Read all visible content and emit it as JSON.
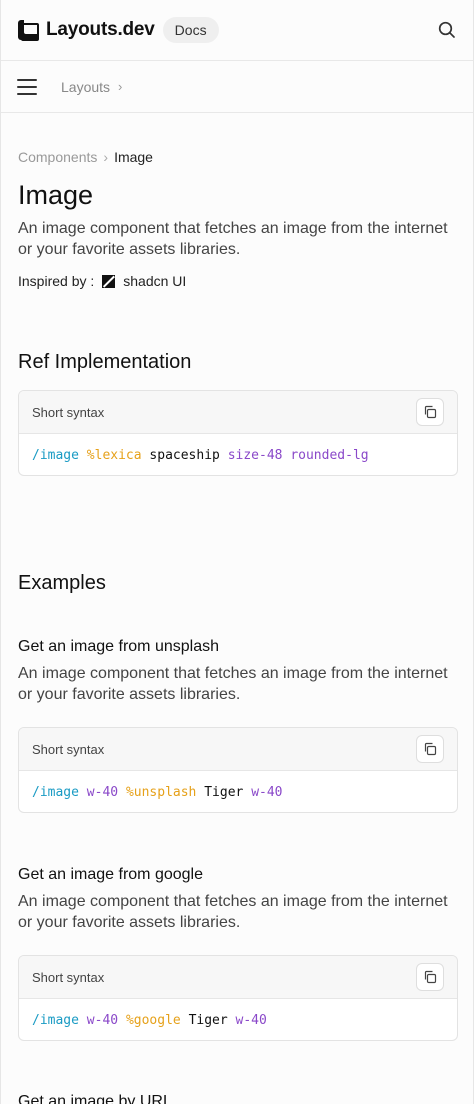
{
  "header": {
    "brand": "Layouts.dev",
    "docs_pill": "Docs"
  },
  "nav": {
    "crumb": "Layouts",
    "chevron": "›"
  },
  "breadcrumb": {
    "parent": "Components",
    "separator": "›",
    "current": "Image"
  },
  "page": {
    "title": "Image",
    "lead": "An image component that fetches an image from the internet or your favorite assets libraries.",
    "inspired_label": "Inspired by :",
    "inspired_name": "shadcn UI"
  },
  "ref": {
    "title": "Ref Implementation",
    "code": {
      "header": "Short syntax",
      "tokens": [
        "/image",
        " ",
        "%lexica",
        " ",
        "spaceship",
        " ",
        "size-48",
        " ",
        "rounded-lg"
      ]
    }
  },
  "examples": {
    "title": "Examples",
    "items": [
      {
        "title": "Get an image from unsplash",
        "desc": "An image component that fetches an image from the internet or your favorite assets libraries.",
        "code_header": "Short syntax",
        "tokens": [
          "/image",
          " ",
          "w-40",
          " ",
          "%unsplash",
          " ",
          "Tiger",
          " ",
          "w-40"
        ]
      },
      {
        "title": "Get an image from google",
        "desc": "An image component that fetches an image from the internet or your favorite assets libraries.",
        "code_header": "Short syntax",
        "tokens": [
          "/image",
          " ",
          "w-40",
          " ",
          "%google",
          " ",
          "Tiger",
          " ",
          "w-40"
        ]
      },
      {
        "title": "Get an image by URL"
      }
    ]
  },
  "colors": {
    "command": "#1a9bc4",
    "variable": "#e6a11a",
    "class": "#8a48c9",
    "text": "#111111"
  }
}
